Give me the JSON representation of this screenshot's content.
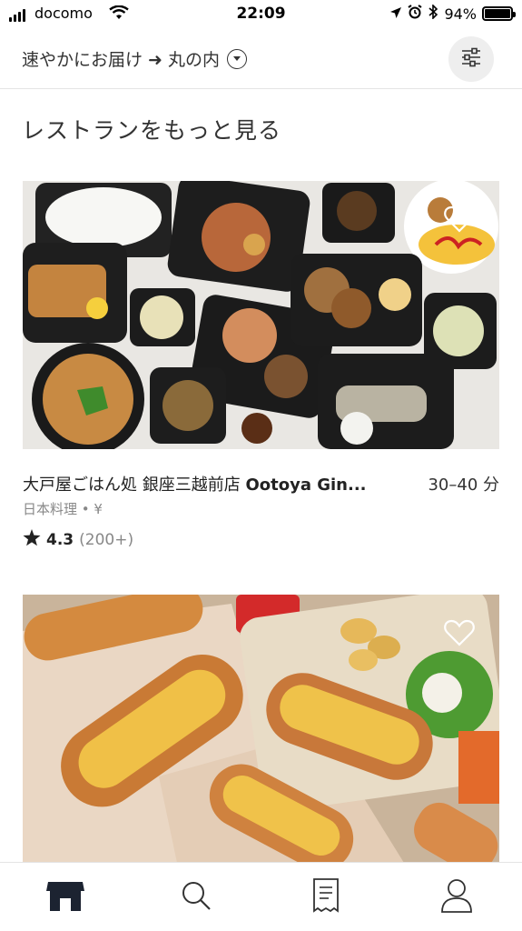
{
  "status_bar": {
    "carrier": "docomo",
    "time": "22:09",
    "battery": "94%"
  },
  "header": {
    "location": "速やかにお届け ➜ 丸の内",
    "dropdown_icon": "chevron-down-circle-icon",
    "filter_icon": "sliders-icon"
  },
  "section_title": "レストランをもっと見る",
  "restaurants": [
    {
      "name_jp": "大戸屋ごはん処 銀座三越前店 ",
      "name_en": "Ootoya Gin...",
      "time": "30–40 分",
      "meta": "日本料理 • ¥",
      "rating": "4.3",
      "reviews": "(200+)"
    },
    {
      "name_jp": "",
      "name_en": "",
      "time": "",
      "meta": "",
      "rating": "",
      "reviews": ""
    }
  ],
  "tabs": [
    {
      "icon": "store-icon",
      "active": true
    },
    {
      "icon": "search-icon",
      "active": false
    },
    {
      "icon": "receipt-icon",
      "active": false
    },
    {
      "icon": "user-icon",
      "active": false
    }
  ]
}
